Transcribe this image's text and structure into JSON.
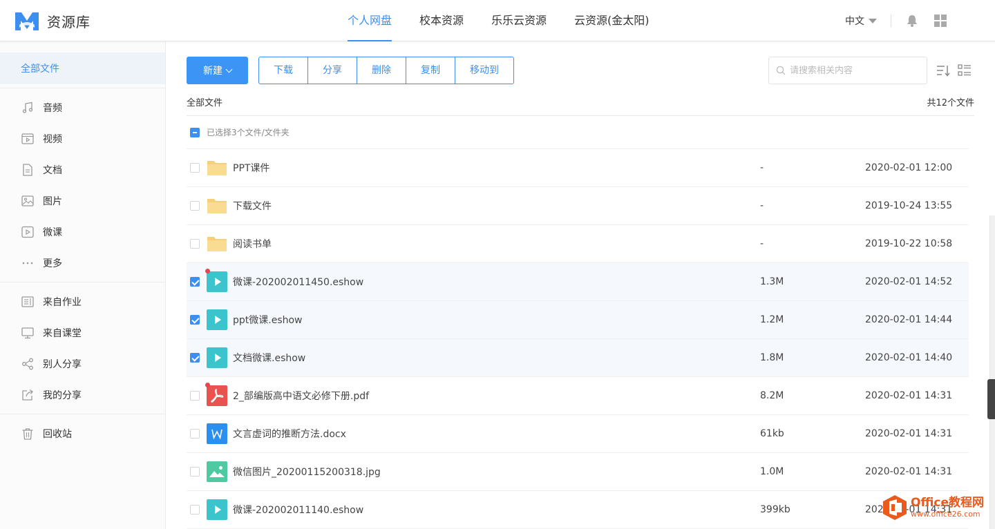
{
  "app": {
    "title": "资源库"
  },
  "nav": {
    "tabs": [
      "个人网盘",
      "校本资源",
      "乐乐云资源",
      "云资源(金太阳)"
    ],
    "active": 0
  },
  "header": {
    "language": "中文"
  },
  "sidebar": {
    "root": "全部文件",
    "items": [
      {
        "label": "音频",
        "icon": "music-icon"
      },
      {
        "label": "视频",
        "icon": "video-icon"
      },
      {
        "label": "文档",
        "icon": "document-icon"
      },
      {
        "label": "图片",
        "icon": "image-icon"
      },
      {
        "label": "微课",
        "icon": "play-icon"
      },
      {
        "label": "更多",
        "icon": "more-icon"
      }
    ],
    "sources": [
      {
        "label": "来自作业",
        "icon": "homework-icon"
      },
      {
        "label": "来自课堂",
        "icon": "classroom-icon"
      },
      {
        "label": "别人分享",
        "icon": "share-icon"
      },
      {
        "label": "我的分享",
        "icon": "my-share-icon"
      }
    ],
    "trash": "回收站"
  },
  "toolbar": {
    "new_label": "新建",
    "actions": [
      "下载",
      "分享",
      "删除",
      "复制",
      "移动到"
    ],
    "search_placeholder": "请搜索相关内容"
  },
  "breadcrumb": "全部文件",
  "total": "共12个文件",
  "selection_text": "已选择3个文件/文件夹",
  "files": [
    {
      "name": "PPT课件",
      "type": "folder",
      "size": "-",
      "date": "2020-02-01 12:00",
      "checked": false,
      "dot": false
    },
    {
      "name": "下载文件",
      "type": "folder",
      "size": "-",
      "date": "2019-10-24 13:55",
      "checked": false,
      "dot": false
    },
    {
      "name": "阅读书单",
      "type": "folder",
      "size": "-",
      "date": "2019-10-22 10:58",
      "checked": false,
      "dot": false
    },
    {
      "name": "微课-202002011450.eshow",
      "type": "eshow",
      "size": "1.3M",
      "date": "2020-02-01 14:52",
      "checked": true,
      "dot": true
    },
    {
      "name": "ppt微课.eshow",
      "type": "eshow",
      "size": "1.2M",
      "date": "2020-02-01 14:44",
      "checked": true,
      "dot": false
    },
    {
      "name": "文档微课.eshow",
      "type": "eshow",
      "size": "1.8M",
      "date": "2020-02-01 14:40",
      "checked": true,
      "dot": false
    },
    {
      "name": "2_部编版高中语文必修下册.pdf",
      "type": "pdf",
      "size": "8.2M",
      "date": "2020-02-01 14:31",
      "checked": false,
      "dot": true
    },
    {
      "name": "文言虚词的推断方法.docx",
      "type": "docx",
      "size": "61kb",
      "date": "2020-02-01 14:31",
      "checked": false,
      "dot": false
    },
    {
      "name": "微信图片_20200115200318.jpg",
      "type": "image",
      "size": "1.0M",
      "date": "2020-02-01 14:31",
      "checked": false,
      "dot": false
    },
    {
      "name": "微课-202002011140.eshow",
      "type": "eshow",
      "size": "399kb",
      "date": "2020-02-01 14:31",
      "checked": false,
      "dot": false
    }
  ],
  "watermark": {
    "title": "Office教程网",
    "url": "www.office26.com"
  },
  "colors": {
    "accent": "#3c8ff0",
    "folder": "#f6cf7a",
    "eshow": "#3cc4cc",
    "pdf": "#e8534f",
    "docx": "#2b8ff0",
    "image": "#4fc9a2"
  }
}
